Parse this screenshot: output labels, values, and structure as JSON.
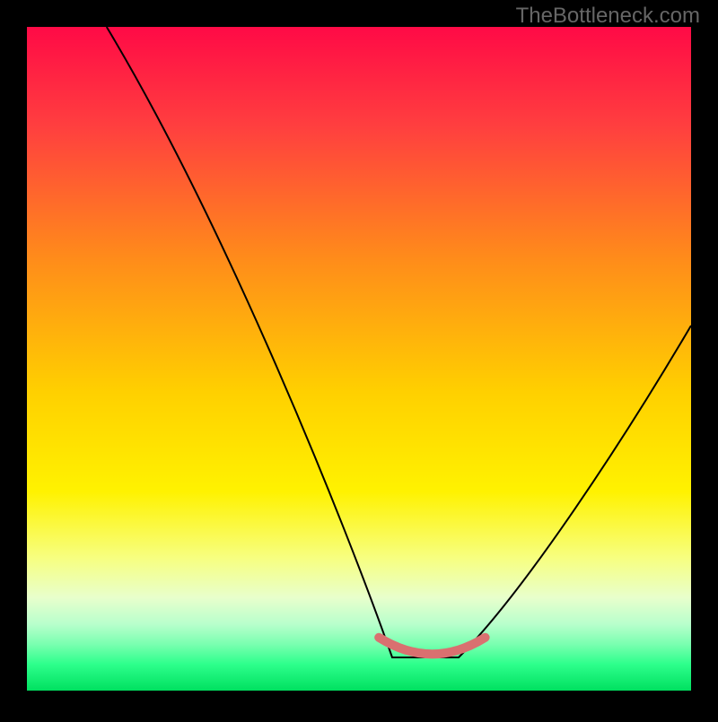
{
  "watermark": "TheBottleneck.com",
  "chart_data": {
    "type": "line",
    "title": "",
    "xlabel": "",
    "ylabel": "",
    "xlim": [
      0,
      100
    ],
    "ylim": [
      0,
      100
    ],
    "grid": false,
    "series": [
      {
        "name": "curve",
        "type": "v-curve",
        "color": "#000000",
        "points": [
          {
            "x": 12,
            "y": 100
          },
          {
            "x": 55,
            "y": 5
          },
          {
            "x": 65,
            "y": 5
          },
          {
            "x": 100,
            "y": 55
          }
        ]
      },
      {
        "name": "highlight-segment",
        "type": "flat",
        "color": "#d97070",
        "points": [
          {
            "x": 55,
            "y": 4
          },
          {
            "x": 67,
            "y": 4
          }
        ]
      }
    ],
    "background_gradient": {
      "type": "vertical",
      "stops": [
        {
          "pos": 0.0,
          "color": "#ff0a46"
        },
        {
          "pos": 0.15,
          "color": "#ff3f3f"
        },
        {
          "pos": 0.35,
          "color": "#ff8c1a"
        },
        {
          "pos": 0.55,
          "color": "#ffd000"
        },
        {
          "pos": 0.7,
          "color": "#fff200"
        },
        {
          "pos": 0.8,
          "color": "#f7ff80"
        },
        {
          "pos": 0.86,
          "color": "#e8ffcc"
        },
        {
          "pos": 0.9,
          "color": "#b8ffcc"
        },
        {
          "pos": 0.93,
          "color": "#7affb0"
        },
        {
          "pos": 0.96,
          "color": "#2eff8c"
        },
        {
          "pos": 1.0,
          "color": "#00e060"
        }
      ]
    }
  }
}
